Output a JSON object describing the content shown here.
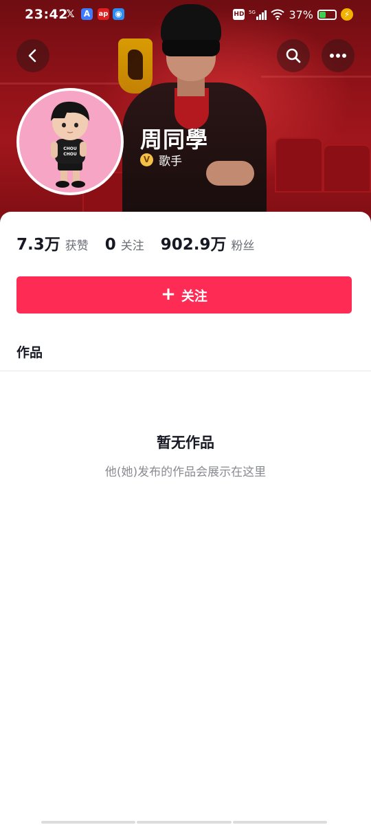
{
  "status_bar": {
    "time": "23:42",
    "apps": [
      "x-icon",
      "app-blue-icon",
      "news-red-icon",
      "map-blue-icon"
    ],
    "network": "5G",
    "hd": "HD",
    "battery_percent": "37%",
    "battery_level": 0.37
  },
  "nav": {
    "back": "chevron-left-icon",
    "search": "search-icon",
    "more": "more-dots-icon"
  },
  "profile": {
    "nickname": "周同學",
    "verified_title": "歌手",
    "verified_icon": "V"
  },
  "stats": [
    {
      "value": "7.3万",
      "label": "获赞"
    },
    {
      "value": "0",
      "label": "关注"
    },
    {
      "value": "902.9万",
      "label": "粉丝"
    }
  ],
  "actions": {
    "follow_plus": "+",
    "follow_label": "关注"
  },
  "tabs": {
    "works": "作品"
  },
  "empty_state": {
    "title": "暂无作品",
    "subtitle": "他(她)发布的作品会展示在这里"
  },
  "colors": {
    "accent": "#fe2c55",
    "cover": "#8f1218",
    "avatar_bg": "#f6a5c5"
  }
}
